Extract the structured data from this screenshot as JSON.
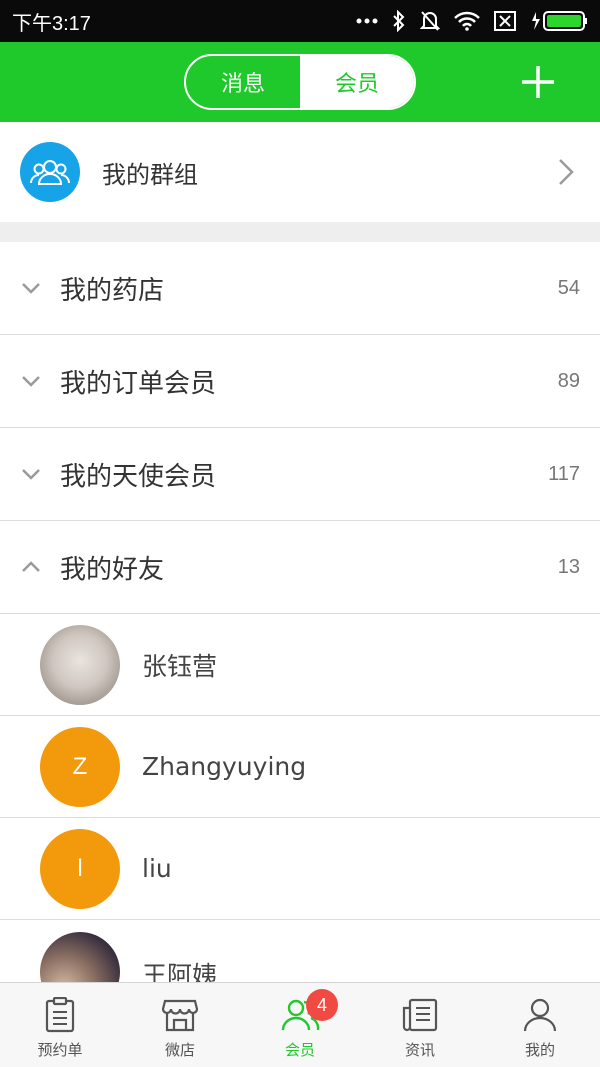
{
  "status_bar": {
    "time": "下午3:17"
  },
  "header": {
    "tabs": [
      {
        "label": "消息",
        "active": false
      },
      {
        "label": "会员",
        "active": true
      }
    ],
    "accent_color": "#1fc92b"
  },
  "groups": {
    "label": "我的群组"
  },
  "categories": [
    {
      "label": "我的药店",
      "count": "54",
      "expanded": false
    },
    {
      "label": "我的订单会员",
      "count": "89",
      "expanded": false
    },
    {
      "label": "我的天使会员",
      "count": "117",
      "expanded": false
    },
    {
      "label": "我的好友",
      "count": "13",
      "expanded": true
    }
  ],
  "friends": [
    {
      "name": "张钰营",
      "avatar_text": "",
      "avatar_type": "photo"
    },
    {
      "name": "Zhangyuying",
      "avatar_text": "Z",
      "avatar_type": "initial"
    },
    {
      "name": "liu",
      "avatar_text": "l",
      "avatar_type": "initial"
    },
    {
      "name": "王阿姨",
      "avatar_text": "",
      "avatar_type": "photo"
    }
  ],
  "bottom_nav": [
    {
      "label": "预约单",
      "icon": "clipboard-icon",
      "active": false
    },
    {
      "label": "微店",
      "icon": "shop-icon",
      "active": false
    },
    {
      "label": "会员",
      "icon": "members-icon",
      "active": true,
      "badge": "4"
    },
    {
      "label": "资讯",
      "icon": "news-icon",
      "active": false
    },
    {
      "label": "我的",
      "icon": "profile-icon",
      "active": false
    }
  ]
}
